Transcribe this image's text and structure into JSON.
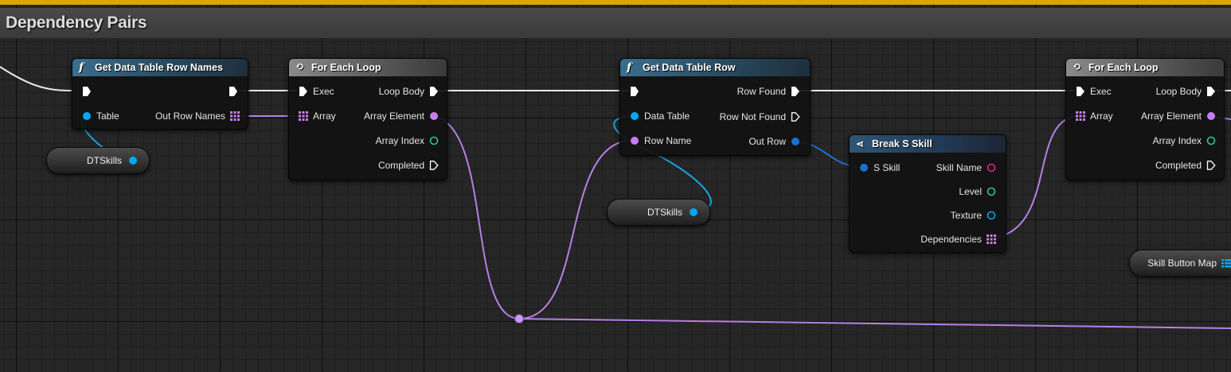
{
  "comment": {
    "title": "Dependency Pairs"
  },
  "colors": {
    "comment_accent": "#e0a20a",
    "object_pin": "#00a8f4",
    "struct_pin": "#1f6fd0",
    "name_pin": "#c77fee",
    "text_pin": "#e0238f",
    "int_pin": "#2ec78e",
    "exec_pin": "#ffffff"
  },
  "nodes": {
    "get_row_names": {
      "title": "Get Data Table Row Names",
      "table": "Table",
      "out_row_names": "Out Row Names"
    },
    "for_each_1": {
      "title": "For Each Loop",
      "exec": "Exec",
      "array": "Array",
      "loop_body": "Loop Body",
      "array_element": "Array Element",
      "array_index": "Array Index",
      "completed": "Completed"
    },
    "get_row": {
      "title": "Get Data Table Row",
      "data_table": "Data Table",
      "row_name": "Row Name",
      "row_found": "Row Found",
      "row_not_found": "Row Not Found",
      "out_row": "Out Row"
    },
    "break_skill": {
      "title": "Break S Skill",
      "s_skill": "S Skill",
      "skill_name": "Skill Name",
      "level": "Level",
      "texture": "Texture",
      "dependencies": "Dependencies"
    },
    "for_each_2": {
      "title": "For Each Loop",
      "exec": "Exec",
      "array": "Array",
      "loop_body": "Loop Body",
      "array_element": "Array Element",
      "array_index": "Array Index",
      "completed": "Completed"
    }
  },
  "variables": {
    "dtskills_1": "DTSkills",
    "dtskills_2": "DTSkills",
    "skill_button_map": "Skill Button Map"
  }
}
